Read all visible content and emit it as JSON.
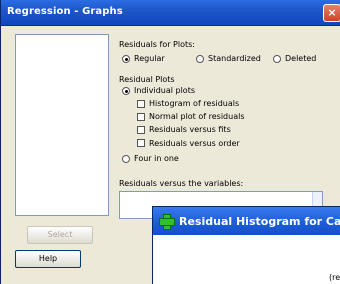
{
  "dialog": {
    "title": "Regression - Graphs",
    "close_glyph": "×",
    "residuals_for_plots": {
      "label": "Residuals for Plots:",
      "options": [
        {
          "label": "Regular",
          "checked": true
        },
        {
          "label": "Standardized",
          "checked": false
        },
        {
          "label": "Deleted",
          "checked": false
        }
      ]
    },
    "residual_plots": {
      "label": "Residual Plots",
      "individual_plots": {
        "label": "Individual plots",
        "checked": true
      },
      "checkboxes": [
        {
          "label": "Histogram of residuals",
          "checked": false
        },
        {
          "label": "Normal plot of residuals",
          "checked": false
        },
        {
          "label": "Residuals versus fits",
          "checked": false
        },
        {
          "label": "Residuals versus order",
          "checked": false
        }
      ],
      "four_in_one": {
        "label": "Four in one",
        "checked": false
      }
    },
    "vars_label": "Residuals versus the variables:",
    "select_button": "Select",
    "help_button": "Help"
  },
  "popup": {
    "title": "Residual Histogram for Ca",
    "body_text": "(re",
    "icon": "plus-icon"
  }
}
